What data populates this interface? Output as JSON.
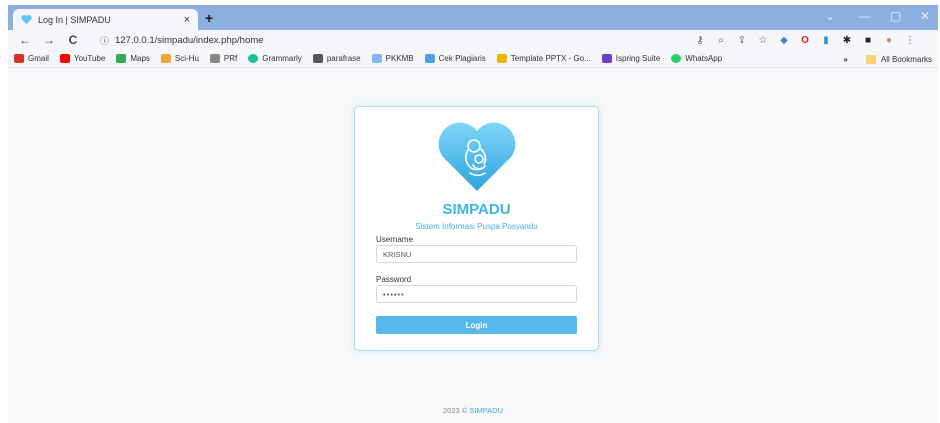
{
  "browser": {
    "tab_title": "Log In | SIMPADU",
    "tab_close": "×",
    "new_tab": "+",
    "window_controls": {
      "collapse": "⌄",
      "minimize": "—",
      "restore": "▢",
      "close": "✕"
    },
    "nav": {
      "back": "←",
      "forward": "→",
      "reload": "C"
    },
    "url": "127.0.0.1/simpadu/index.php/home",
    "bookmarks": [
      {
        "label": "Gmail",
        "color": "#d93025"
      },
      {
        "label": "YouTube",
        "color": "#ff0000"
      },
      {
        "label": "Maps",
        "color": "#34a853"
      },
      {
        "label": "Sci-Hu",
        "color": "#f2a33a"
      },
      {
        "label": "PRf",
        "color": "#888888"
      },
      {
        "label": "Grammarly",
        "color": "#15c39a"
      },
      {
        "label": "parafrase",
        "color": "#555555"
      },
      {
        "label": "PKKMB",
        "color": "#8ab4f8"
      },
      {
        "label": "Cek Plagiaris",
        "color": "#4aa3df"
      },
      {
        "label": "Template PPTX - Go...",
        "color": "#f4b400"
      },
      {
        "label": "Ispring Suite",
        "color": "#6a3fc1"
      },
      {
        "label": "WhatsApp",
        "color": "#25d366"
      }
    ],
    "bookmarks_more": "»",
    "all_bookmarks": "All Bookmarks"
  },
  "login": {
    "app_name": "SIMPADU",
    "subtitle": "Sistem Informasi Puspa Posyandu",
    "username_label": "Username",
    "username_value": "KRISNU",
    "password_label": "Password",
    "password_value": "••••••",
    "login_button": "Login"
  },
  "footer": {
    "prefix": "2023 ©",
    "brand": "SIMPADU"
  },
  "colors": {
    "accent": "#3bb6e9",
    "button": "#57b7ea",
    "titlebar": "#8bb0e0"
  }
}
